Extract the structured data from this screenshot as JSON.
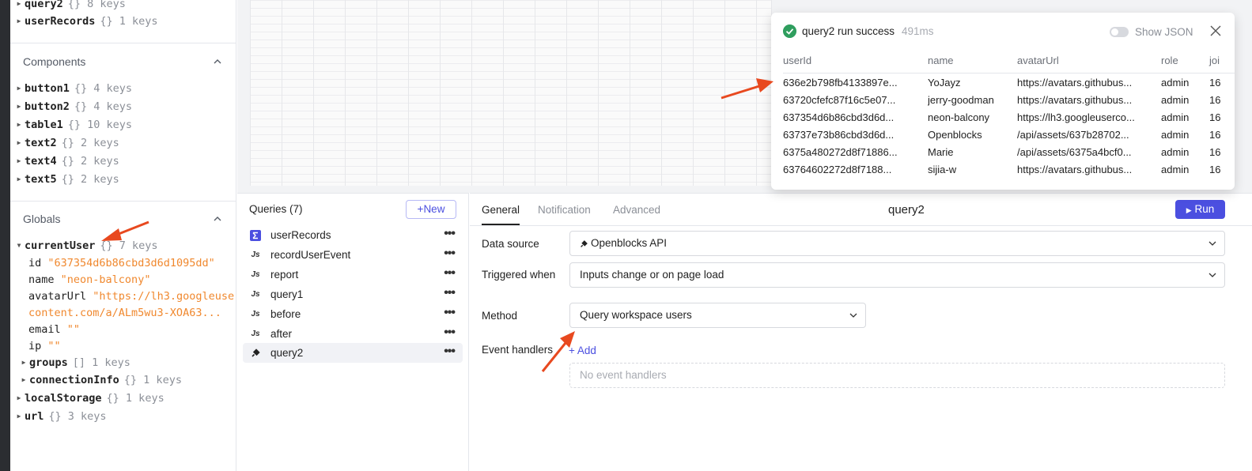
{
  "left_panel": {
    "top_items": [
      {
        "key": "query2",
        "meta": "{} 8 keys"
      },
      {
        "key": "userRecords",
        "meta": "{} 1 keys"
      }
    ],
    "components": {
      "title": "Components",
      "items": [
        {
          "key": "button1",
          "meta": "{} 4 keys"
        },
        {
          "key": "button2",
          "meta": "{} 4 keys"
        },
        {
          "key": "table1",
          "meta": "{} 10 keys"
        },
        {
          "key": "text2",
          "meta": "{} 2 keys"
        },
        {
          "key": "text4",
          "meta": "{} 2 keys"
        },
        {
          "key": "text5",
          "meta": "{} 2 keys"
        }
      ]
    },
    "globals": {
      "title": "Globals",
      "current_user": {
        "key": "currentUser",
        "meta": "{} 7 keys"
      },
      "fields": [
        {
          "key": "id",
          "value": "\"637354d6b86cbd3d6d1095dd\""
        },
        {
          "key": "name",
          "value": "\"neon-balcony\""
        },
        {
          "key": "avatarUrl",
          "value": "\"https://lh3.googleuser"
        },
        {
          "key": "",
          "value": "content.com/a/ALm5wu3-XOA63..."
        },
        {
          "key": "email",
          "value": "\"\""
        },
        {
          "key": "ip",
          "value": "\"\""
        }
      ],
      "sub_items": [
        {
          "key": "groups",
          "meta": "[] 1 keys"
        },
        {
          "key": "connectionInfo",
          "meta": "{} 1 keys"
        }
      ],
      "other_items": [
        {
          "key": "localStorage",
          "meta": "{} 1 keys"
        },
        {
          "key": "url",
          "meta": "{} 3 keys"
        }
      ]
    }
  },
  "queries": {
    "title": "Queries (7)",
    "new_label": "New",
    "items": [
      {
        "label": "userRecords",
        "icon": "sigma-icon"
      },
      {
        "label": "recordUserEvent",
        "icon": "js-icon"
      },
      {
        "label": "report",
        "icon": "js-icon"
      },
      {
        "label": "query1",
        "icon": "js-icon"
      },
      {
        "label": "before",
        "icon": "js-icon"
      },
      {
        "label": "after",
        "icon": "js-icon"
      },
      {
        "label": "query2",
        "icon": "plug-icon"
      }
    ],
    "selected": "query2"
  },
  "editor": {
    "tabs": [
      "General",
      "Notification",
      "Advanced"
    ],
    "title": "query2",
    "run_label": "Run",
    "data_source_label": "Data source",
    "data_source_value": "Openblocks API",
    "triggered_label": "Triggered when",
    "triggered_value": "Inputs change or on page load",
    "method_label": "Method",
    "method_value": "Query workspace users",
    "event_handlers_label": "Event handlers",
    "add_label": "+ Add",
    "no_handlers": "No event handlers"
  },
  "result_popup": {
    "title": "query2 run success",
    "time": "491ms",
    "show_json_label": "Show JSON",
    "columns": [
      "userId",
      "name",
      "avatarUrl",
      "role",
      "joi"
    ],
    "rows": [
      [
        "636e2b798fb4133897e...",
        "YoJayz",
        "https://avatars.githubus...",
        "admin",
        "16"
      ],
      [
        "63720cfefc87f16c5e07...",
        "jerry-goodman",
        "https://avatars.githubus...",
        "admin",
        "16"
      ],
      [
        "637354d6b86cbd3d6d...",
        "neon-balcony",
        "https://lh3.googleuserco...",
        "admin",
        "16"
      ],
      [
        "63737e73b86cbd3d6d...",
        "Openblocks",
        "/api/assets/637b28702...",
        "admin",
        "16"
      ],
      [
        "6375a480272d8f71886...",
        "Marie",
        "/api/assets/6375a4bcf0...",
        "admin",
        "16"
      ],
      [
        "63764602272d8f7188...",
        "sijia-w",
        "https://avatars.githubus...",
        "admin",
        "16"
      ]
    ]
  },
  "colors": {
    "accent": "#4b4fe0",
    "success": "#2f9e5e",
    "string_value": "#f0882e",
    "annotation_arrow": "#e8491f"
  }
}
